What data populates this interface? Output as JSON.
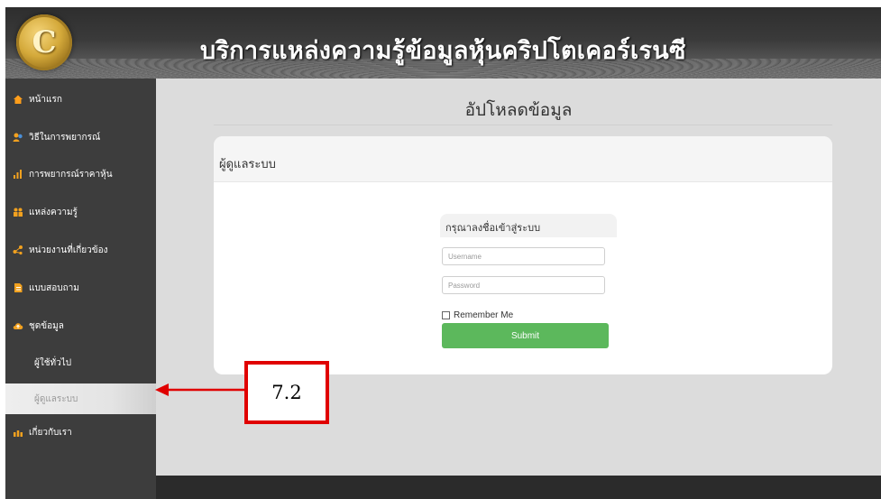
{
  "header": {
    "title": "บริการแหล่งความรู้ข้อมูลหุ้นคริปโตเคอร์เรนซี",
    "logo_letter": "C"
  },
  "sidebar": {
    "items": [
      {
        "label": "หน้าแรก",
        "icon": "home-icon",
        "color": "#ff9e1b"
      },
      {
        "label": "วิธีในการพยากรณ์",
        "icon": "user-group-icon",
        "color": "#f2a11f"
      },
      {
        "label": "การพยากรณ์ราคาหุ้น",
        "icon": "bar-chart-icon",
        "color": "#f2a11f"
      },
      {
        "label": "แหล่งความรู้",
        "icon": "people-icon",
        "color": "#f2a11f"
      },
      {
        "label": "หน่วยงานที่เกี่ยวข้อง",
        "icon": "network-icon",
        "color": "#f2a11f"
      },
      {
        "label": "แบบสอบถาม",
        "icon": "document-icon",
        "color": "#f2a11f"
      },
      {
        "label": "ชุดข้อมูล",
        "icon": "cloud-upload-icon",
        "color": "#f2a11f"
      },
      {
        "label": "ผู้ใช้ทั่วไป",
        "icon": "",
        "color": ""
      },
      {
        "label": "ผู้ดูแลระบบ",
        "icon": "",
        "color": ""
      },
      {
        "label": "เกี่ยวกับเรา",
        "icon": "team-icon",
        "color": "#f2a11f"
      }
    ]
  },
  "main": {
    "page_title": "อัปโหลดข้อมูล",
    "panel_title": "ผู้ดูแลระบบ",
    "login": {
      "title": "กรุณาลงชื่อเข้าสู่ระบบ",
      "username_placeholder": "Username",
      "password_placeholder": "Password",
      "remember_label": "Remember Me",
      "submit_label": "Submit"
    }
  },
  "annotation": {
    "label": "7.2",
    "color": "#e00000"
  },
  "colors": {
    "submit": "#5cb85c",
    "sidebar_bg": "#3d3d3d",
    "main_bg": "#dcdcdc"
  }
}
